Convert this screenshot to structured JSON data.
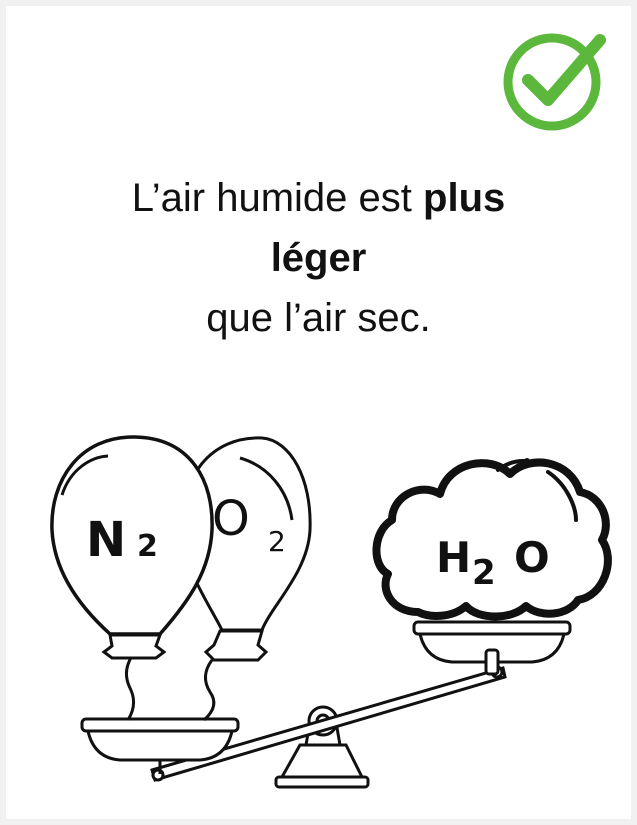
{
  "status": {
    "icon": "checkmark-circle-icon",
    "color": "#5cb83c"
  },
  "statement": {
    "line1_prefix": "L’air humide est ",
    "line1_bold": "plus",
    "line2_bold": "léger",
    "line3": "que l’air sec."
  },
  "illustration": {
    "left_pan": {
      "balloon_1": {
        "label": "N",
        "subscript": "2"
      },
      "balloon_2": {
        "label": "O",
        "subscript": "2"
      }
    },
    "right_pan": {
      "cloud": {
        "label_h": "H",
        "subscript": "2",
        "label_o": "O"
      }
    }
  }
}
